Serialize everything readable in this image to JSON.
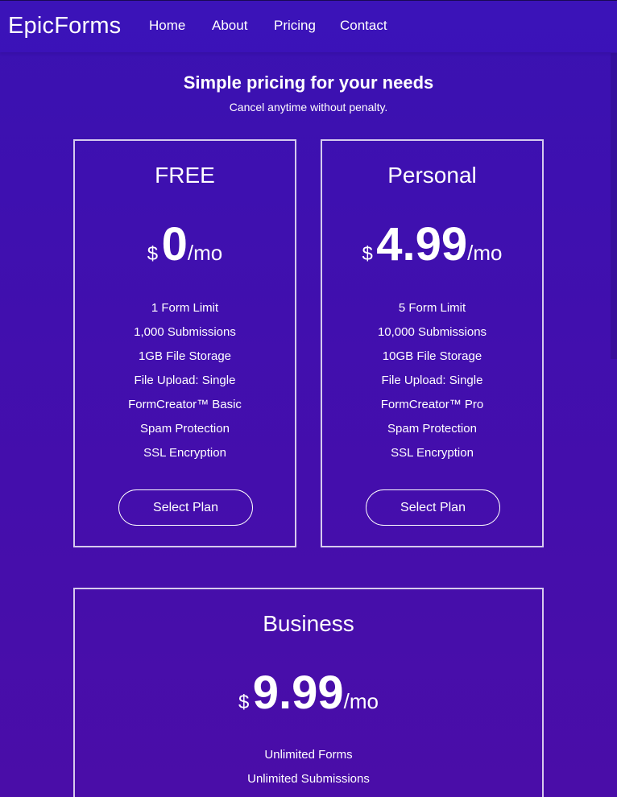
{
  "colors": {
    "background_top": "#3a12b2",
    "background_bottom": "#4a0da8",
    "text": "#ffffff",
    "card_border": "#ffffff"
  },
  "nav": {
    "brand": "EpicForms",
    "links": [
      "Home",
      "About",
      "Pricing",
      "Contact"
    ]
  },
  "header": {
    "title": "Simple pricing for your needs",
    "subtitle": "Cancel anytime without penalty."
  },
  "plans": [
    {
      "name": "FREE",
      "currency": "$",
      "price": "0",
      "period": "/mo",
      "features": [
        "1 Form Limit",
        "1,000 Submissions",
        "1GB File Storage",
        "File Upload: Single",
        "FormCreator™ Basic",
        "Spam Protection",
        "SSL Encryption"
      ],
      "button": "Select Plan"
    },
    {
      "name": "Personal",
      "currency": "$",
      "price": "4.99",
      "period": "/mo",
      "features": [
        "5 Form Limit",
        "10,000 Submissions",
        "10GB File Storage",
        "File Upload: Single",
        "FormCreator™ Pro",
        "Spam Protection",
        "SSL Encryption"
      ],
      "button": "Select Plan"
    },
    {
      "name": "Business",
      "currency": "$",
      "price": "9.99",
      "period": "/mo",
      "features": [
        "Unlimited Forms",
        "Unlimited Submissions"
      ]
    }
  ]
}
